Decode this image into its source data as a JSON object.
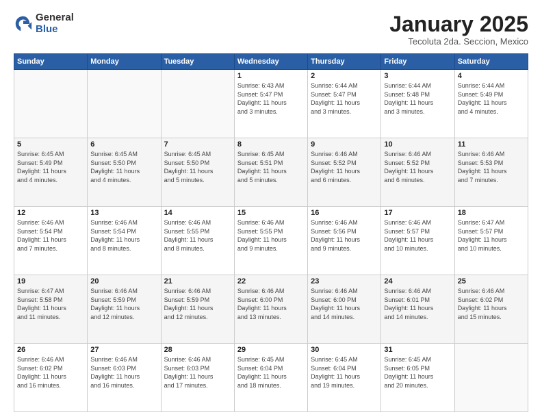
{
  "header": {
    "logo_general": "General",
    "logo_blue": "Blue",
    "month_title": "January 2025",
    "location": "Tecoluta 2da. Seccion, Mexico"
  },
  "weekdays": [
    "Sunday",
    "Monday",
    "Tuesday",
    "Wednesday",
    "Thursday",
    "Friday",
    "Saturday"
  ],
  "weeks": [
    [
      {
        "day": "",
        "info": ""
      },
      {
        "day": "",
        "info": ""
      },
      {
        "day": "",
        "info": ""
      },
      {
        "day": "1",
        "info": "Sunrise: 6:43 AM\nSunset: 5:47 PM\nDaylight: 11 hours\nand 3 minutes."
      },
      {
        "day": "2",
        "info": "Sunrise: 6:44 AM\nSunset: 5:47 PM\nDaylight: 11 hours\nand 3 minutes."
      },
      {
        "day": "3",
        "info": "Sunrise: 6:44 AM\nSunset: 5:48 PM\nDaylight: 11 hours\nand 3 minutes."
      },
      {
        "day": "4",
        "info": "Sunrise: 6:44 AM\nSunset: 5:49 PM\nDaylight: 11 hours\nand 4 minutes."
      }
    ],
    [
      {
        "day": "5",
        "info": "Sunrise: 6:45 AM\nSunset: 5:49 PM\nDaylight: 11 hours\nand 4 minutes."
      },
      {
        "day": "6",
        "info": "Sunrise: 6:45 AM\nSunset: 5:50 PM\nDaylight: 11 hours\nand 4 minutes."
      },
      {
        "day": "7",
        "info": "Sunrise: 6:45 AM\nSunset: 5:50 PM\nDaylight: 11 hours\nand 5 minutes."
      },
      {
        "day": "8",
        "info": "Sunrise: 6:45 AM\nSunset: 5:51 PM\nDaylight: 11 hours\nand 5 minutes."
      },
      {
        "day": "9",
        "info": "Sunrise: 6:46 AM\nSunset: 5:52 PM\nDaylight: 11 hours\nand 6 minutes."
      },
      {
        "day": "10",
        "info": "Sunrise: 6:46 AM\nSunset: 5:52 PM\nDaylight: 11 hours\nand 6 minutes."
      },
      {
        "day": "11",
        "info": "Sunrise: 6:46 AM\nSunset: 5:53 PM\nDaylight: 11 hours\nand 7 minutes."
      }
    ],
    [
      {
        "day": "12",
        "info": "Sunrise: 6:46 AM\nSunset: 5:54 PM\nDaylight: 11 hours\nand 7 minutes."
      },
      {
        "day": "13",
        "info": "Sunrise: 6:46 AM\nSunset: 5:54 PM\nDaylight: 11 hours\nand 8 minutes."
      },
      {
        "day": "14",
        "info": "Sunrise: 6:46 AM\nSunset: 5:55 PM\nDaylight: 11 hours\nand 8 minutes."
      },
      {
        "day": "15",
        "info": "Sunrise: 6:46 AM\nSunset: 5:55 PM\nDaylight: 11 hours\nand 9 minutes."
      },
      {
        "day": "16",
        "info": "Sunrise: 6:46 AM\nSunset: 5:56 PM\nDaylight: 11 hours\nand 9 minutes."
      },
      {
        "day": "17",
        "info": "Sunrise: 6:46 AM\nSunset: 5:57 PM\nDaylight: 11 hours\nand 10 minutes."
      },
      {
        "day": "18",
        "info": "Sunrise: 6:47 AM\nSunset: 5:57 PM\nDaylight: 11 hours\nand 10 minutes."
      }
    ],
    [
      {
        "day": "19",
        "info": "Sunrise: 6:47 AM\nSunset: 5:58 PM\nDaylight: 11 hours\nand 11 minutes."
      },
      {
        "day": "20",
        "info": "Sunrise: 6:46 AM\nSunset: 5:59 PM\nDaylight: 11 hours\nand 12 minutes."
      },
      {
        "day": "21",
        "info": "Sunrise: 6:46 AM\nSunset: 5:59 PM\nDaylight: 11 hours\nand 12 minutes."
      },
      {
        "day": "22",
        "info": "Sunrise: 6:46 AM\nSunset: 6:00 PM\nDaylight: 11 hours\nand 13 minutes."
      },
      {
        "day": "23",
        "info": "Sunrise: 6:46 AM\nSunset: 6:00 PM\nDaylight: 11 hours\nand 14 minutes."
      },
      {
        "day": "24",
        "info": "Sunrise: 6:46 AM\nSunset: 6:01 PM\nDaylight: 11 hours\nand 14 minutes."
      },
      {
        "day": "25",
        "info": "Sunrise: 6:46 AM\nSunset: 6:02 PM\nDaylight: 11 hours\nand 15 minutes."
      }
    ],
    [
      {
        "day": "26",
        "info": "Sunrise: 6:46 AM\nSunset: 6:02 PM\nDaylight: 11 hours\nand 16 minutes."
      },
      {
        "day": "27",
        "info": "Sunrise: 6:46 AM\nSunset: 6:03 PM\nDaylight: 11 hours\nand 16 minutes."
      },
      {
        "day": "28",
        "info": "Sunrise: 6:46 AM\nSunset: 6:03 PM\nDaylight: 11 hours\nand 17 minutes."
      },
      {
        "day": "29",
        "info": "Sunrise: 6:45 AM\nSunset: 6:04 PM\nDaylight: 11 hours\nand 18 minutes."
      },
      {
        "day": "30",
        "info": "Sunrise: 6:45 AM\nSunset: 6:04 PM\nDaylight: 11 hours\nand 19 minutes."
      },
      {
        "day": "31",
        "info": "Sunrise: 6:45 AM\nSunset: 6:05 PM\nDaylight: 11 hours\nand 20 minutes."
      },
      {
        "day": "",
        "info": ""
      }
    ]
  ]
}
